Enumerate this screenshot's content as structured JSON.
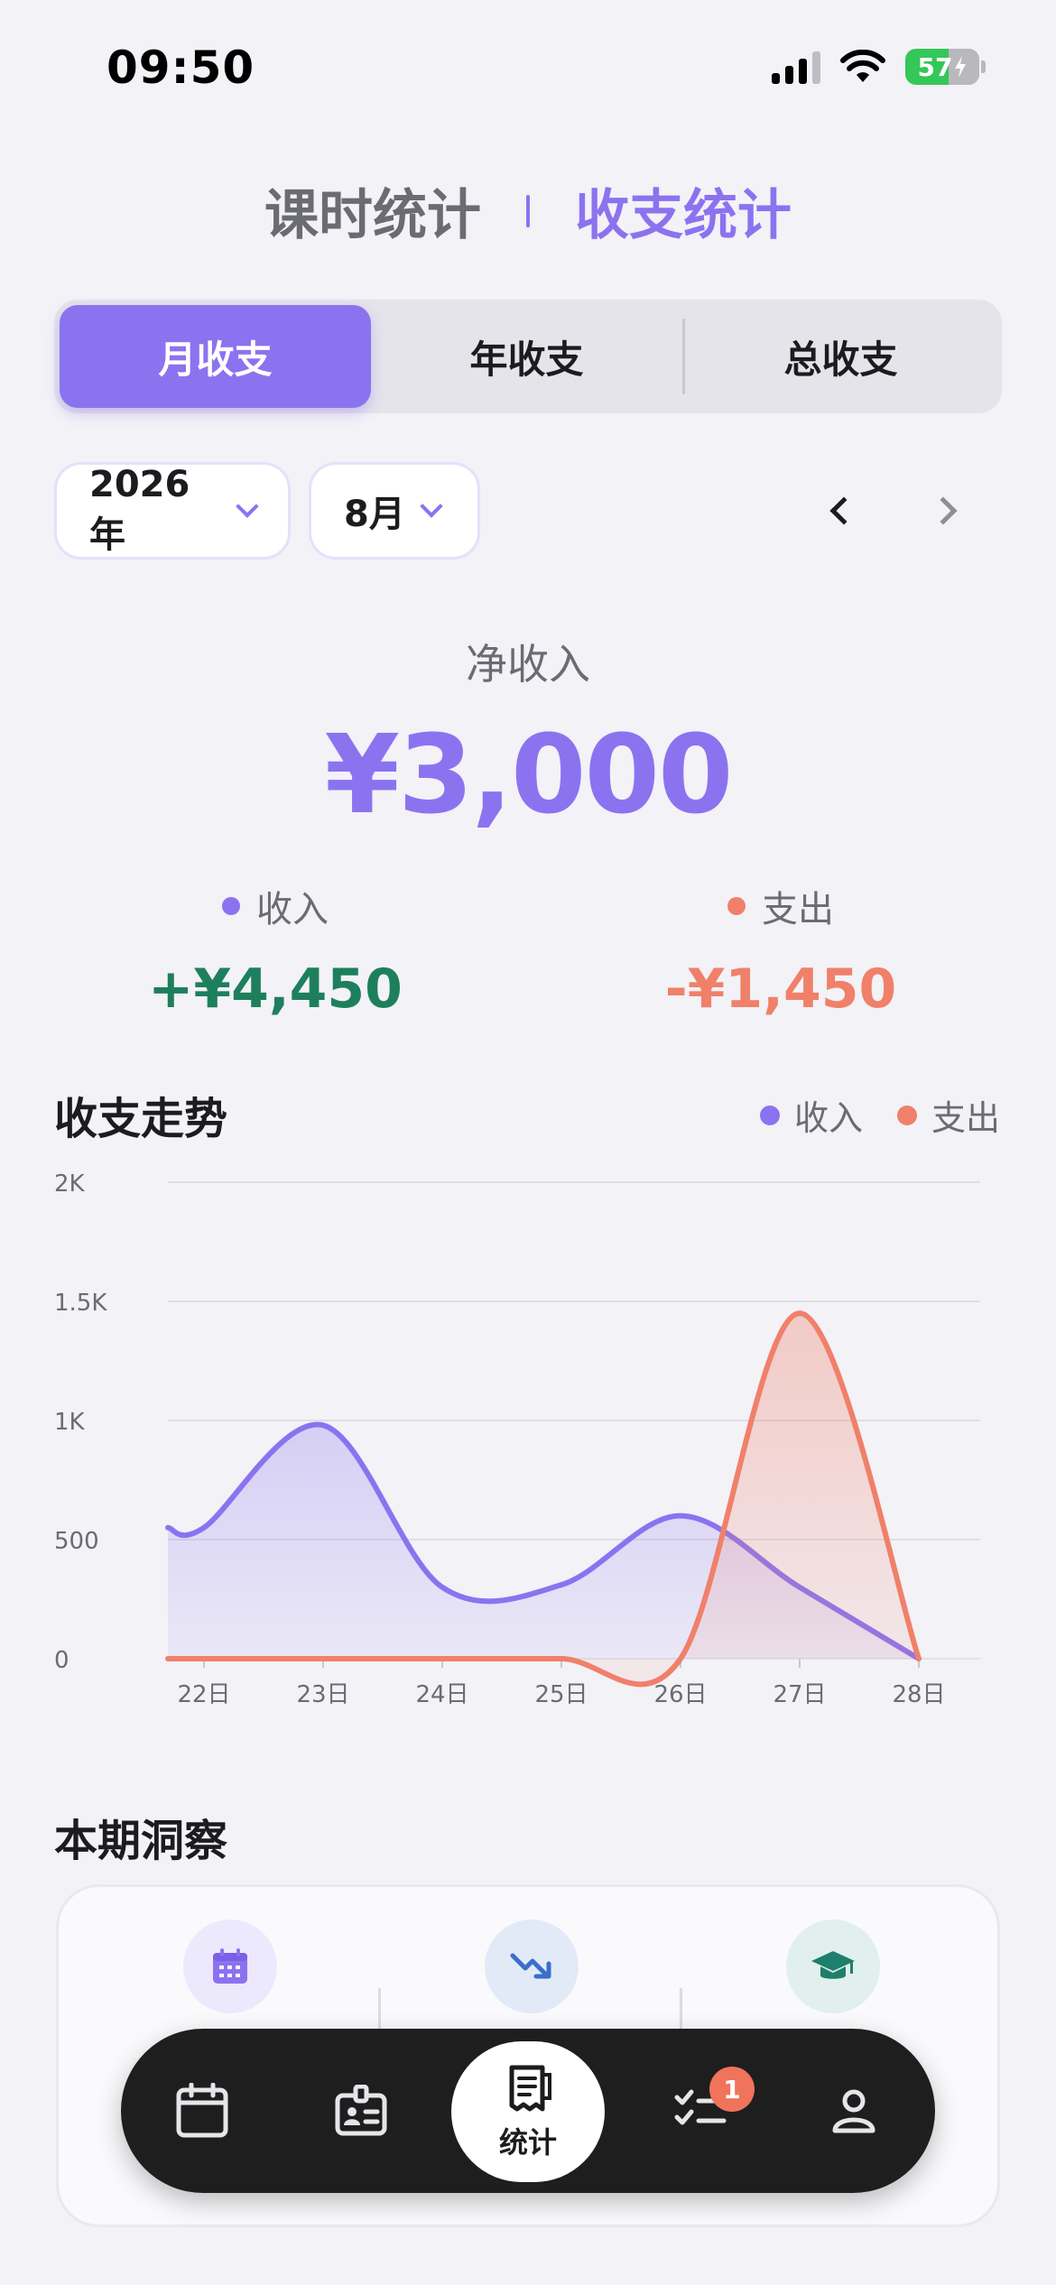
{
  "status_bar": {
    "time": "09:50",
    "battery": "57"
  },
  "page_tabs": [
    {
      "label": "课时统计",
      "active": false
    },
    {
      "label": "收支统计",
      "active": true
    }
  ],
  "period_tabs": [
    {
      "label": "月收支",
      "active": true
    },
    {
      "label": "年收支",
      "active": false
    },
    {
      "label": "总收支",
      "active": false
    }
  ],
  "selectors": {
    "year": "2026年",
    "month": "8月"
  },
  "summary": {
    "net_label": "净收入",
    "net_value": "¥3,000",
    "income_label": "收入",
    "income_value": "+¥4,450",
    "expense_label": "支出",
    "expense_value": "-¥1,450"
  },
  "colors": {
    "accent": "#8B73F0",
    "income": "#8B73F0",
    "expense": "#F0806A",
    "income_value": "#1E7F5C"
  },
  "trend": {
    "title": "收支走势"
  },
  "chart_data": {
    "type": "area",
    "categories": [
      "22日",
      "23日",
      "24日",
      "25日",
      "26日",
      "27日",
      "28日"
    ],
    "series": [
      {
        "name": "收入",
        "values": [
          550,
          980,
          300,
          310,
          600,
          300,
          0
        ],
        "color": "#8B73F0"
      },
      {
        "name": "支出",
        "values": [
          0,
          0,
          0,
          0,
          0,
          1450,
          0
        ],
        "color": "#F0806A"
      }
    ],
    "yticks": [
      "0",
      "500",
      "1K",
      "1.5K",
      "2K"
    ],
    "ylim": [
      0,
      2000
    ],
    "grid": true,
    "legend": "top-right"
  },
  "insights": {
    "title": "本期洞察",
    "items": [
      {
        "icon": "calendar-icon",
        "bg": "#EDE9FD",
        "color": "#8B73F0"
      },
      {
        "icon": "trend-down-icon",
        "bg": "#E3EAF7",
        "color": "#3B6FC9"
      },
      {
        "icon": "graduation-cap-icon",
        "bg": "#E1F0EC",
        "color": "#1E7F6C"
      }
    ]
  },
  "bottom_nav": {
    "items": [
      "calendar-icon",
      "id-card-icon",
      "stats-icon",
      "checklist-icon",
      "person-icon"
    ],
    "center_label": "统计",
    "badge": "1"
  }
}
